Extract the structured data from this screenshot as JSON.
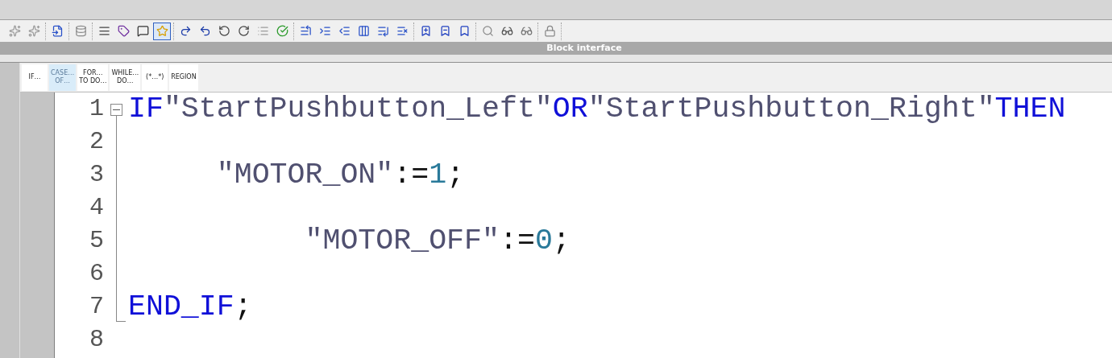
{
  "toolbar": {
    "groups": [
      {
        "buttons": [
          {
            "selected": false
          },
          {
            "selected": false
          }
        ]
      },
      {
        "buttons": [
          {
            "selected": false
          }
        ]
      },
      {
        "buttons": [
          {
            "selected": false
          }
        ]
      },
      {
        "buttons": [
          {
            "selected": false
          },
          {
            "selected": false
          },
          {
            "selected": false
          },
          {
            "selected": true
          }
        ]
      },
      {
        "buttons": [
          {
            "selected": false
          },
          {
            "selected": false
          },
          {
            "selected": false
          },
          {
            "selected": false
          },
          {
            "selected": false
          },
          {
            "selected": false
          }
        ]
      },
      {
        "buttons": [
          {
            "selected": false
          },
          {
            "selected": false
          },
          {
            "selected": false
          },
          {
            "selected": false
          },
          {
            "selected": false
          },
          {
            "selected": false
          }
        ]
      },
      {
        "buttons": [
          {
            "selected": false
          },
          {
            "selected": false
          },
          {
            "selected": false
          }
        ]
      },
      {
        "buttons": [
          {
            "selected": false
          },
          {
            "selected": false
          },
          {
            "selected": false
          }
        ]
      },
      {
        "buttons": [
          {
            "selected": false
          }
        ]
      }
    ]
  },
  "panel_bar": {
    "title": "Block interface"
  },
  "snippets": [
    {
      "lines": [
        "IF…"
      ],
      "selected": false
    },
    {
      "lines": [
        "CASE…",
        "OF…"
      ],
      "selected": true
    },
    {
      "lines": [
        "FOR…",
        "TO DO…"
      ],
      "selected": false
    },
    {
      "lines": [
        "WHILE…",
        "DO…"
      ],
      "selected": false
    },
    {
      "lines": [
        "(*…*)"
      ],
      "selected": false
    },
    {
      "lines": [
        "REGION"
      ],
      "selected": false
    }
  ],
  "code": [
    {
      "number": "1",
      "kind": "start",
      "tokens": [
        {
          "kind": "keyword",
          "text": "IF"
        },
        {
          "kind": "tag",
          "text": "\"StartPushbutton_Left\""
        },
        {
          "kind": "keyword",
          "text": "OR"
        },
        {
          "kind": "tag",
          "text": "\"StartPushbutton_Right\""
        },
        {
          "kind": "keyword",
          "text": "THEN"
        }
      ]
    },
    {
      "number": "2",
      "kind": "inside"
    },
    {
      "number": "3",
      "kind": "inside",
      "tokens": [
        {
          "kind": "tag",
          "text": "     \"MOTOR_ON\""
        },
        {
          "kind": "punct",
          "text": ":="
        },
        {
          "kind": "number",
          "text": "1"
        },
        {
          "kind": "punct",
          "text": ";"
        }
      ]
    },
    {
      "number": "4",
      "kind": "inside"
    },
    {
      "number": "5",
      "kind": "inside",
      "tokens": [
        {
          "kind": "tag",
          "text": "          \"MOTOR_OFF\""
        },
        {
          "kind": "punct",
          "text": ":="
        },
        {
          "kind": "number",
          "text": "0"
        },
        {
          "kind": "punct",
          "text": ";"
        }
      ]
    },
    {
      "number": "6",
      "kind": "inside"
    },
    {
      "number": "7",
      "kind": "end",
      "tokens": [
        {
          "kind": "keyword",
          "text": "END_IF"
        },
        {
          "kind": "punct",
          "text": ";"
        }
      ]
    },
    {
      "number": "8",
      "kind": "plain"
    }
  ]
}
